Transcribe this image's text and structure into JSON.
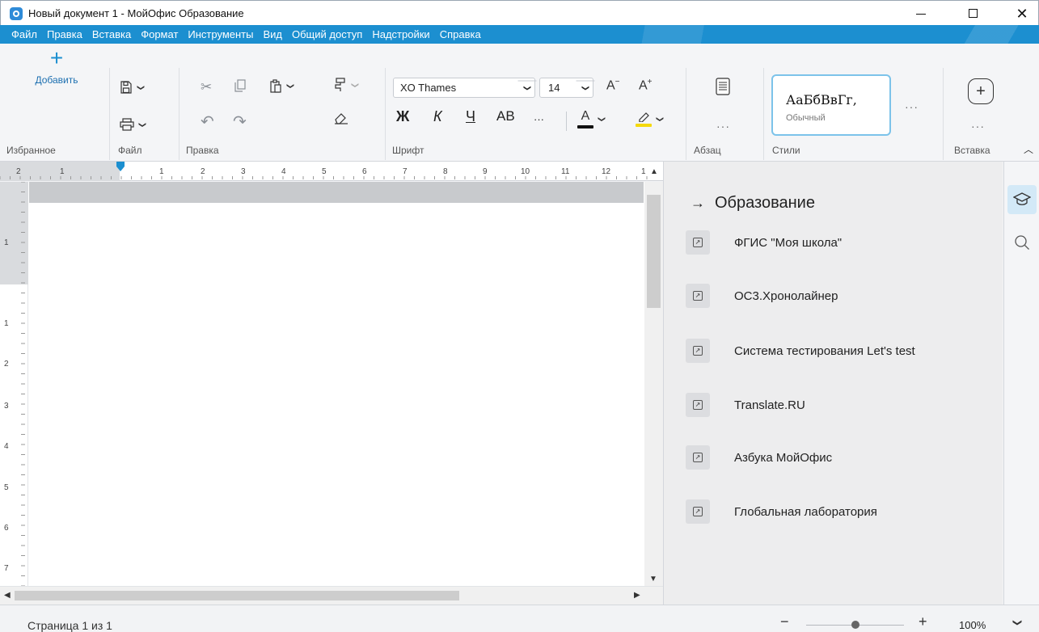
{
  "window": {
    "title": "Новый документ 1 - МойОфис Образование",
    "close_glyph": "✕"
  },
  "menu": [
    "Файл",
    "Правка",
    "Вставка",
    "Формат",
    "Инструменты",
    "Вид",
    "Общий доступ",
    "Надстройки",
    "Справка"
  ],
  "ribbon": {
    "favorites": {
      "add_label": "Добавить",
      "group_label": "Избранное"
    },
    "file": {
      "group_label": "Файл"
    },
    "edit": {
      "group_label": "Правка"
    },
    "font": {
      "family": "XO Thames",
      "size": "14",
      "bold": "Ж",
      "italic": "К",
      "underline": "Ч",
      "caps": "АВ",
      "more": "···",
      "text_color_letter": "А",
      "group_label": "Шрифт"
    },
    "paragraph": {
      "group_label": "Абзац",
      "more": "···"
    },
    "styles": {
      "sample": "АаБбВвГг,",
      "name": "Обычный",
      "more": "···",
      "group_label": "Стили"
    },
    "insert": {
      "group_label": "Вставка",
      "more": "···"
    }
  },
  "ruler": {
    "left_marks": [
      "2",
      "1"
    ],
    "marks": [
      "1",
      "2",
      "3",
      "4",
      "5",
      "6",
      "7",
      "8",
      "9",
      "10",
      "11",
      "12",
      "1"
    ]
  },
  "vruler": {
    "top_marks": [
      "1"
    ],
    "marks": [
      "1",
      "2",
      "3",
      "4",
      "5",
      "6",
      "7"
    ]
  },
  "panel": {
    "title": "Образование",
    "items": [
      "ФГИС \"Моя школа\"",
      "ОС3.Хронолайнер",
      "Система тестирования Let's test",
      "Translate.RU",
      "Азбука МойОфис",
      "Глобальная лаборатория"
    ]
  },
  "status": {
    "page": "Страница 1 из 1",
    "zoom": "100%",
    "zoom_level_percent": 100
  },
  "colors": {
    "accent": "#1c8fd0",
    "highlight_yellow": "#f5d90a"
  }
}
